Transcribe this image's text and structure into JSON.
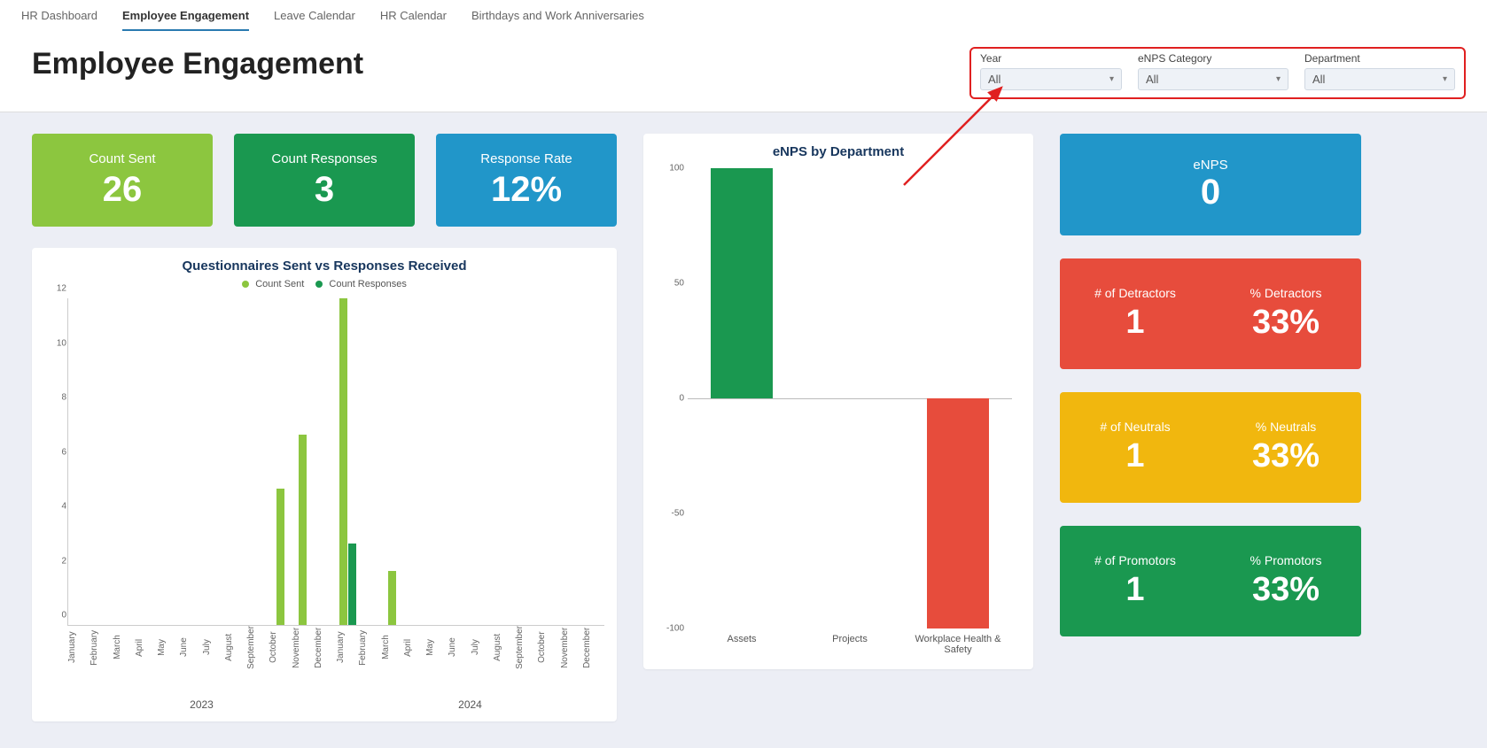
{
  "tabs": {
    "items": [
      "HR Dashboard",
      "Employee Engagement",
      "Leave Calendar",
      "HR Calendar",
      "Birthdays and Work Anniversaries"
    ],
    "active_index": 1
  },
  "page_title": "Employee Engagement",
  "filters": {
    "year": {
      "label": "Year",
      "value": "All"
    },
    "cat": {
      "label": "eNPS Category",
      "value": "All"
    },
    "dept": {
      "label": "Department",
      "value": "All"
    }
  },
  "kpis": {
    "sent": {
      "label": "Count Sent",
      "value": "26"
    },
    "resp": {
      "label": "Count Responses",
      "value": "3"
    },
    "rate": {
      "label": "Response Rate",
      "value": "12%"
    }
  },
  "enps_card": {
    "label": "eNPS",
    "value": "0"
  },
  "stat_cards": {
    "detractors": {
      "count_label": "# of Detractors",
      "count": "1",
      "pct_label": "% Detractors",
      "pct": "33%"
    },
    "neutrals": {
      "count_label": "# of Neutrals",
      "count": "1",
      "pct_label": "% Neutrals",
      "pct": "33%"
    },
    "promoters": {
      "count_label": "# of Promotors",
      "count": "1",
      "pct_label": "% Promotors",
      "pct": "33%"
    }
  },
  "chart_data": [
    {
      "id": "sent_vs_responses",
      "type": "bar",
      "title": "Questionnaires Sent vs Responses Received",
      "legend": {
        "sent": "Count Sent",
        "resp": "Count Responses"
      },
      "colors": {
        "sent": "#8cc63f",
        "resp": "#1a9850"
      },
      "ylabel": "",
      "xlabel": "",
      "ylim": [
        0,
        12
      ],
      "y_ticks": [
        0,
        2,
        4,
        6,
        8,
        10,
        12
      ],
      "years": [
        "2023",
        "2024"
      ],
      "months": [
        "January",
        "February",
        "March",
        "April",
        "May",
        "June",
        "July",
        "August",
        "September",
        "October",
        "November",
        "December"
      ],
      "series": [
        {
          "name": "Count Sent",
          "values": {
            "2023": [
              0,
              0,
              0,
              0,
              0,
              0,
              0,
              0,
              0,
              5,
              7,
              0
            ],
            "2024": [
              12,
              0,
              2,
              0,
              0,
              0,
              0,
              0,
              0,
              0,
              0,
              0
            ]
          }
        },
        {
          "name": "Count Responses",
          "values": {
            "2023": [
              0,
              0,
              0,
              0,
              0,
              0,
              0,
              0,
              0,
              0,
              0,
              0
            ],
            "2024": [
              3,
              0,
              0,
              0,
              0,
              0,
              0,
              0,
              0,
              0,
              0,
              0
            ]
          }
        }
      ]
    },
    {
      "id": "enps_by_department",
      "type": "bar",
      "title": "eNPS by Department",
      "ylim": [
        -100,
        100
      ],
      "y_ticks": [
        -100,
        -50,
        0,
        50,
        100
      ],
      "categories": [
        "Assets",
        "Projects",
        "Workplace Health & Safety"
      ],
      "values": [
        100,
        0,
        -100
      ],
      "colors": {
        "pos": "#1a9850",
        "neg": "#e74c3c"
      }
    }
  ]
}
